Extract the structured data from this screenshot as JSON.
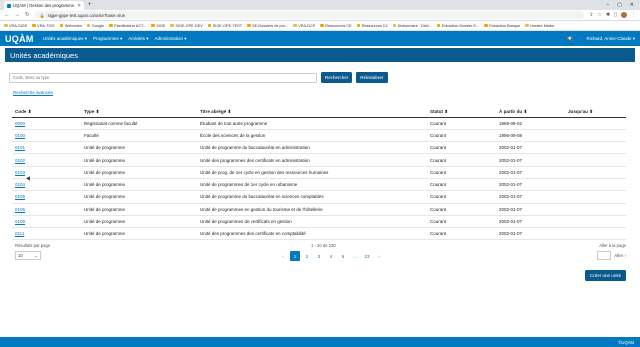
{
  "browser": {
    "tab_title": "UQAM | Gestion des programme...",
    "url": "sigpe-gppe-test.uqam.ca/unite?base=true",
    "bookmarks": [
      "VRA-SIGE",
      "VRA-TICE",
      "Webnotes",
      "Google",
      "Planificateur ACT...",
      "SIGE",
      "SIGE-GPE-DEV",
      "SIGE-GPE-TEST",
      "SE-Dossiers de pro...",
      "VRA-DCP",
      "Ressources CE",
      "Ressources C4",
      "Dictionnaire - Dicti...",
      "Extraction Dossier E...",
      "Extraction Banque",
      "Horaire Maitre"
    ]
  },
  "app": {
    "logo": "UQÀM",
    "menu": [
      "Unités académiques ▾",
      "Programmes ▾",
      "Activités ▾",
      "Administration ▾"
    ],
    "user": "Richard, Annie-Claude ▾"
  },
  "page": {
    "title": "Unités académiques",
    "search_placeholder": "Code, titres ou type",
    "search_button": "Rechercher",
    "reset_button": "Réinitialiser",
    "advanced_link": "Recherche avancée"
  },
  "table": {
    "headers": {
      "code": "Code ⬍",
      "type": "Type ⬍",
      "title": "Titre abrégé ⬍",
      "status": "Statut ⬍",
      "from": "À partir du ⬍",
      "until": "Jusqu'au ⬍"
    },
    "rows": [
      {
        "code": "0000",
        "type": "Registrariat comme faculté",
        "title": "Étudiant de tout autre programme",
        "status": "Courant",
        "from": "1969-09-02",
        "until": ""
      },
      {
        "code": "0100",
        "type": "Faculté",
        "title": "École des sciences de la gestion",
        "status": "Courant",
        "from": "1996-09-08",
        "until": ""
      },
      {
        "code": "0101",
        "type": "Unité de programme",
        "title": "Unité de programme du baccalauréat en administration",
        "status": "Courant",
        "from": "2002-01-07",
        "until": ""
      },
      {
        "code": "0102",
        "type": "Unité de programme",
        "title": "Unité des programmes des certificats en administration",
        "status": "Courant",
        "from": "2002-01-07",
        "until": ""
      },
      {
        "code": "0103",
        "type": "Unité de programme",
        "title": "Unité de prog. de 1er cycle en gestion des ressources humaines",
        "status": "Courant",
        "from": "2002-01-07",
        "until": ""
      },
      {
        "code": "0104",
        "type": "Unité de programme",
        "title": "Unité de programmes de 1er cycle en urbanisme",
        "status": "Courant",
        "from": "2002-01-07",
        "until": ""
      },
      {
        "code": "0105",
        "type": "Unité de programme",
        "title": "Unité de programme du baccalauréat en sciences comptables",
        "status": "Courant",
        "from": "2002-01-07",
        "until": ""
      },
      {
        "code": "0106",
        "type": "Unité de programme",
        "title": "Unité de programmes en gestion du tourisme et de l'hôtellerie",
        "status": "Courant",
        "from": "2002-01-07",
        "until": ""
      },
      {
        "code": "0109",
        "type": "Unité de programme",
        "title": "Unité de programmes de certificats en gestion",
        "status": "Courant",
        "from": "2002-01-07",
        "until": ""
      },
      {
        "code": "0111",
        "type": "Unité de programme",
        "title": "Unité des programmes des certificats en comptabilité",
        "status": "Courant",
        "from": "2002-01-07",
        "until": ""
      }
    ]
  },
  "pagination": {
    "results_per_page_label": "Résultats par page",
    "results_per_page_value": "10",
    "info": "1 - 10 de 230",
    "prev": "‹",
    "pages": [
      "1",
      "2",
      "3",
      "4",
      "5",
      "...",
      "23"
    ],
    "next": "›",
    "goto_label": "Aller à la page",
    "goto_button": "Aller ›"
  },
  "create_button": "Créer une unité",
  "footer": "©UQÀM"
}
